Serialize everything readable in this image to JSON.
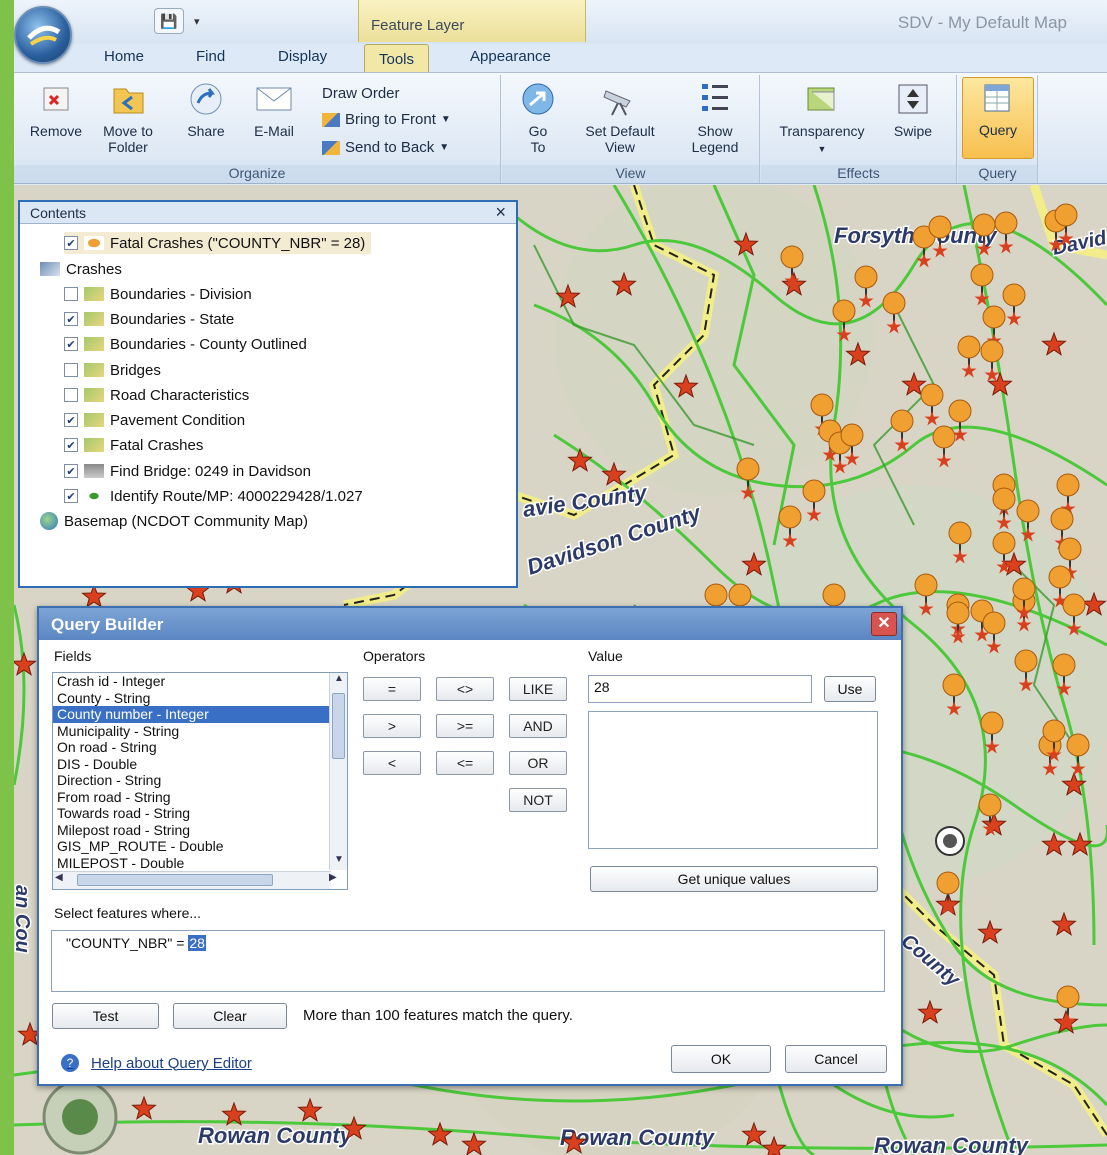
{
  "titlebar": {
    "context_tab": "Feature Layer",
    "window_title": "SDV - My Default Map"
  },
  "tabs": [
    "Home",
    "Find",
    "Display",
    "Tools",
    "Appearance"
  ],
  "ribbon": {
    "organize": {
      "label": "Organize",
      "remove": "Remove",
      "move_to_folder": "Move to Folder",
      "share": "Share",
      "email": "E-Mail",
      "draw_order": "Draw Order",
      "bring_to_front": "Bring to Front",
      "send_to_back": "Send to Back"
    },
    "view": {
      "label": "View",
      "go_to": "Go To",
      "set_default_view": "Set Default View",
      "show_legend": "Show Legend"
    },
    "effects": {
      "label": "Effects",
      "transparency": "Transparency",
      "swipe": "Swipe"
    },
    "query": {
      "label": "Query",
      "query": "Query"
    }
  },
  "contents": {
    "title": "Contents",
    "layers": [
      {
        "label": "Fatal Crashes (\"COUNTY_NBR\" = 28)",
        "checked": true,
        "icon": "crash-layer-icon"
      },
      {
        "label": "Crashes",
        "checked": null,
        "icon": "query-icon"
      },
      {
        "label": "Boundaries - Division",
        "checked": false,
        "icon": "layer-icon"
      },
      {
        "label": "Boundaries - State",
        "checked": true,
        "icon": "layer-icon"
      },
      {
        "label": "Boundaries - County Outlined",
        "checked": true,
        "icon": "layer-icon"
      },
      {
        "label": "Bridges",
        "checked": false,
        "icon": "layer-icon"
      },
      {
        "label": "Road Characteristics",
        "checked": false,
        "icon": "layer-icon"
      },
      {
        "label": "Pavement Condition",
        "checked": true,
        "icon": "layer-icon"
      },
      {
        "label": "Fatal Crashes",
        "checked": true,
        "icon": "layer-icon"
      },
      {
        "label": "Find Bridge: 0249 in Davidson",
        "checked": true,
        "icon": "bridge-icon"
      },
      {
        "label": "Identify Route/MP: 4000229428/1.027",
        "checked": true,
        "icon": "point-icon"
      },
      {
        "label": "Basemap (NCDOT Community Map)",
        "checked": null,
        "icon": "globe-icon"
      }
    ]
  },
  "map": {
    "labels": [
      "Forsyth County",
      "Davids",
      "avie County",
      "Davidson County",
      "Rowan County",
      "Rowan County",
      "Rowan County",
      "County",
      "an Cou"
    ],
    "colors": {
      "road": "#4cc93a",
      "boundary_fill": "#f7f27a",
      "marker": "#f0a030",
      "star": "#d9401d"
    }
  },
  "query_builder": {
    "title": "Query Builder",
    "fields_label": "Fields",
    "operators_label": "Operators",
    "value_label": "Value",
    "fields": [
      "Crash id - Integer",
      "County - String",
      "County number - Integer",
      "Municipality - String",
      "On road - String",
      "DIS - Double",
      "Direction - String",
      "From road - String",
      "Towards road - String",
      "Milepost road - String",
      "GIS_MP_ROUTE - Double",
      "MILEPOST - Double"
    ],
    "selected_field": "County number - Integer",
    "operators": [
      "=",
      "<>",
      "LIKE",
      ">",
      ">=",
      "AND",
      "<",
      "<=",
      "OR",
      "NOT"
    ],
    "value": "28",
    "use_button": "Use",
    "get_unique_values": "Get unique values",
    "select_where_label": "Select features where...",
    "expression_prefix": "\"COUNTY_NBR\" = ",
    "expression_selected": "28",
    "test_button": "Test",
    "clear_button": "Clear",
    "status": "More than 100 features match the query.",
    "help_link": "Help about Query Editor",
    "ok_button": "OK",
    "cancel_button": "Cancel"
  }
}
